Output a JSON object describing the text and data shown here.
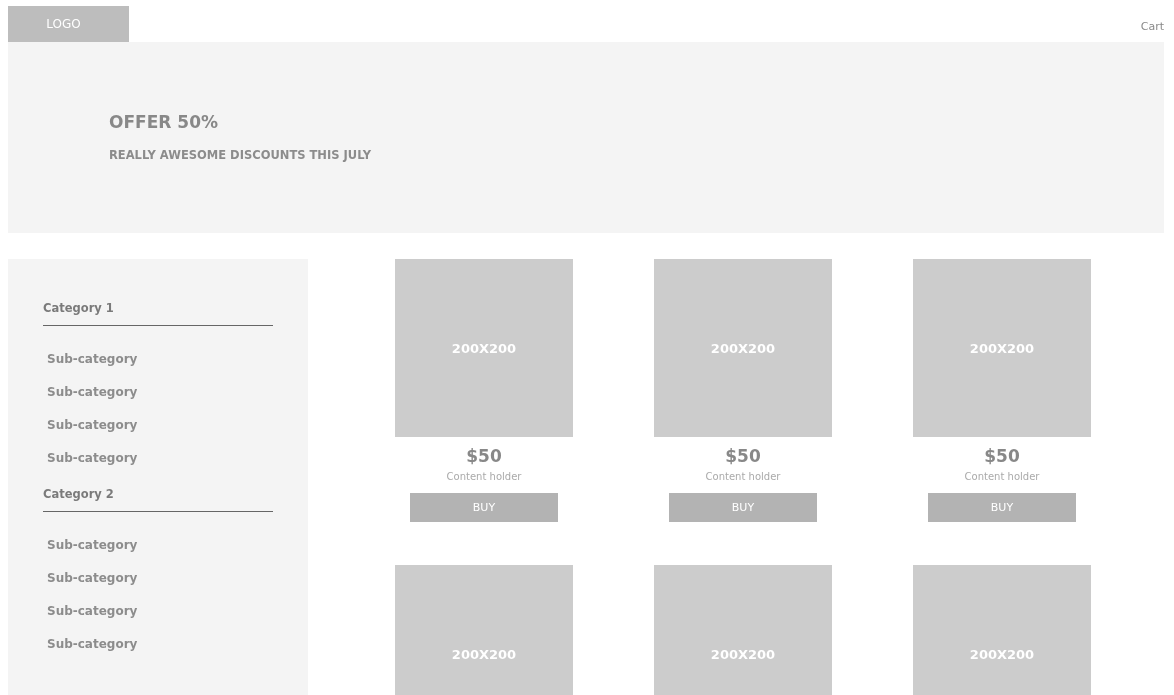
{
  "header": {
    "logo": "LOGO",
    "cart": "Cart"
  },
  "hero": {
    "title": "OFFER 50%",
    "subtitle": "REALLY AWESOME DISCOUNTS THIS JULY"
  },
  "sidebar": {
    "categories": [
      {
        "name": "Category 1",
        "children": [
          {
            "name": "Sub-category"
          },
          {
            "name": "Sub-category"
          },
          {
            "name": "Sub-category"
          },
          {
            "name": "Sub-category"
          }
        ]
      },
      {
        "name": "Category 2",
        "children": [
          {
            "name": "Sub-category"
          },
          {
            "name": "Sub-category"
          },
          {
            "name": "Sub-category"
          },
          {
            "name": "Sub-category"
          }
        ]
      }
    ]
  },
  "products": [
    {
      "image_label": "200X200",
      "price": "$50",
      "description": "Content holder",
      "button": "BUY"
    },
    {
      "image_label": "200X200",
      "price": "$50",
      "description": "Content holder",
      "button": "BUY"
    },
    {
      "image_label": "200X200",
      "price": "$50",
      "description": "Content holder",
      "button": "BUY"
    },
    {
      "image_label": "200X200"
    },
    {
      "image_label": "200X200"
    },
    {
      "image_label": "200X200"
    }
  ]
}
